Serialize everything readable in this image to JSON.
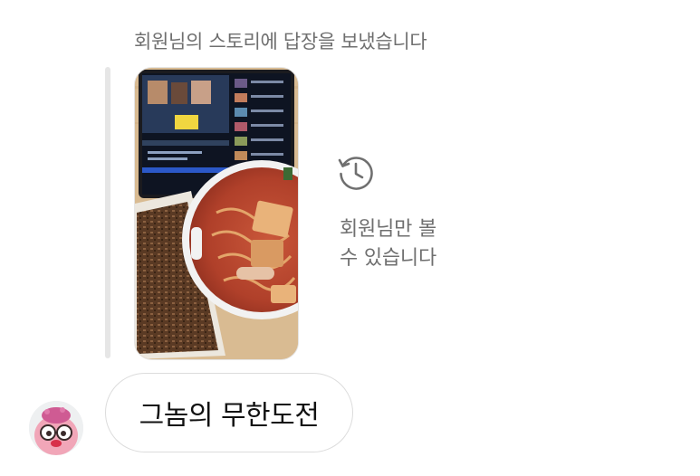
{
  "story_reply": {
    "caption": "회원님의 스토리에 답장을 보냈습니다",
    "visibility_line1": "회원님만 볼",
    "visibility_line2": "수 있습니다",
    "visibility_icon": "history-icon",
    "thumbnail_alt": "스토리 사진"
  },
  "message": {
    "text": "그놈의 무한도전",
    "sender_avatar_alt": "프로필 사진"
  },
  "colors": {
    "secondary_text": "#6f6f6f",
    "primary_text": "#111111",
    "bubble_border": "#dcdcdc",
    "quote_bar": "#e6e6e6"
  }
}
